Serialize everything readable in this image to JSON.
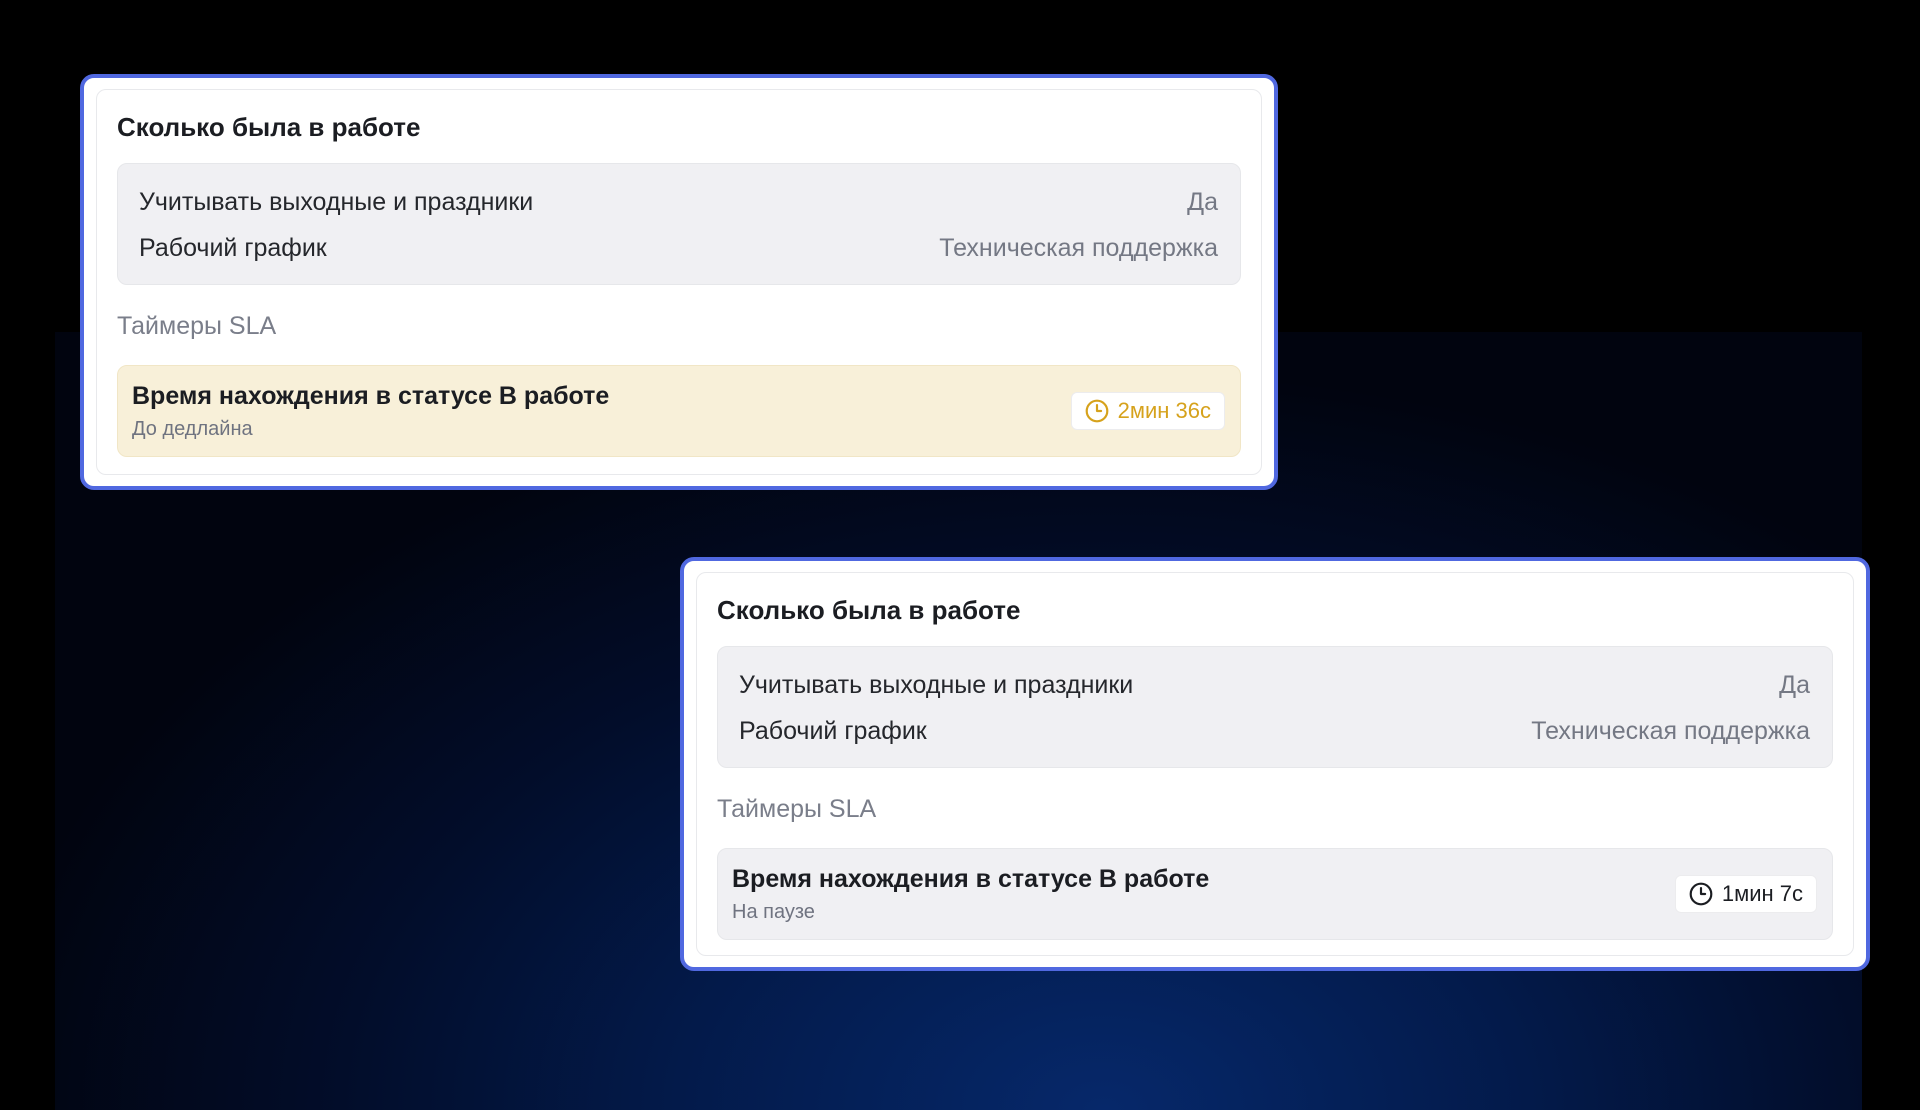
{
  "cards": [
    {
      "title": "Сколько была в работе",
      "settings": [
        {
          "label": "Учитывать выходные и праздники",
          "value": "Да"
        },
        {
          "label": "Рабочий график",
          "value": "Техническая поддержка"
        }
      ],
      "section_label": "Таймеры SLA",
      "sla": {
        "name": "Время нахождения в статусе В работе",
        "status": "До дедлайна",
        "timer": "2мин 36с",
        "timer_icon": "clock-icon",
        "state_color": "#d6a21c"
      }
    },
    {
      "title": "Сколько была в работе",
      "settings": [
        {
          "label": "Учитывать выходные и праздники",
          "value": "Да"
        },
        {
          "label": "Рабочий график",
          "value": "Техническая поддержка"
        }
      ],
      "section_label": "Таймеры SLA",
      "sla": {
        "name": "Время нахождения в статусе В работе",
        "status": "На паузе",
        "timer": "1мин 7с",
        "timer_icon": "clock-icon",
        "state_color": "#1b1d22"
      }
    }
  ],
  "colors": {
    "frame_border": "#5068e0",
    "warning_background": "#f8f0d9",
    "neutral_background": "#f0f0f3"
  }
}
